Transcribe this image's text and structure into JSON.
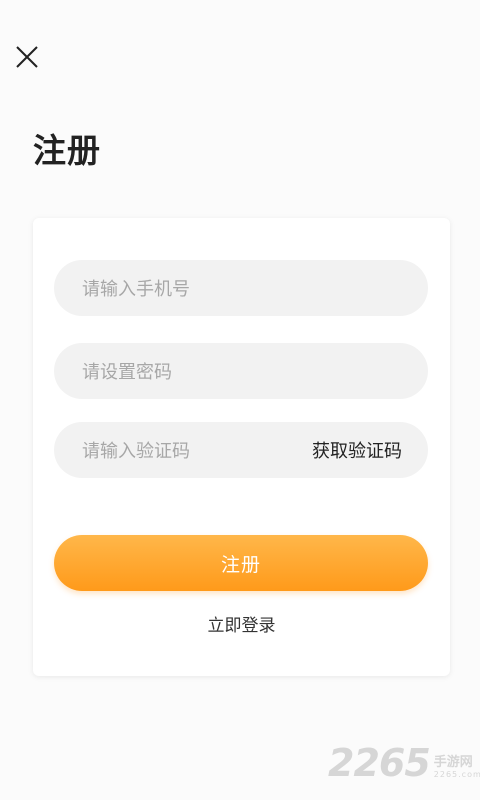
{
  "header": {
    "title": "注册"
  },
  "form": {
    "phone_placeholder": "请输入手机号",
    "password_placeholder": "请设置密码",
    "code_placeholder": "请输入验证码",
    "get_code_label": "获取验证码",
    "register_label": "注册",
    "login_link": "立即登录"
  },
  "watermark": {
    "number": "2265",
    "site_cn": "手游网",
    "site_domain": "2265.com"
  },
  "colors": {
    "accent_top": "#ffb74a",
    "accent_bottom": "#ff9a1a",
    "field_bg": "#f2f2f2",
    "placeholder": "#a7a7a7"
  },
  "icons": {
    "close": "close-icon"
  }
}
